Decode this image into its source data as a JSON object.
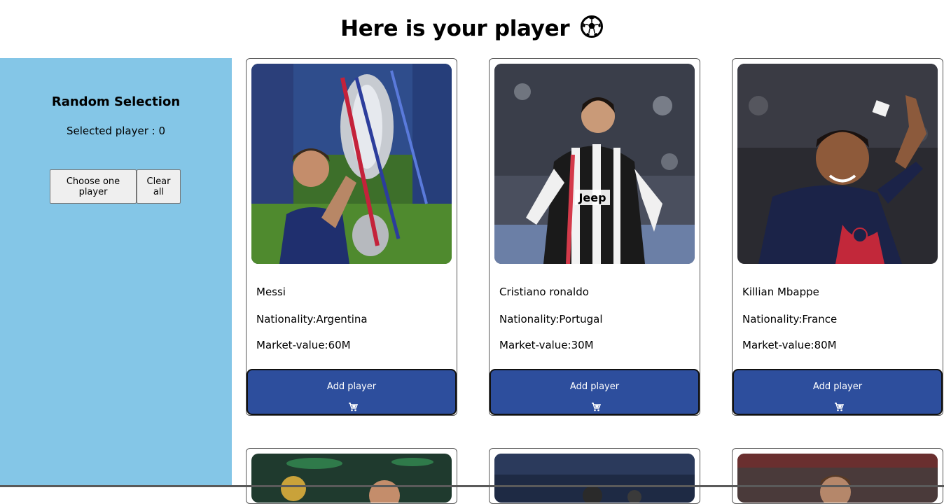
{
  "header": {
    "title": "Here is your player",
    "icon": "soccer-ball-icon"
  },
  "sidebar": {
    "title": "Random Selection",
    "selected_text": "Selected player : 0",
    "choose_label": "Choose one player",
    "clear_label": "Clear all",
    "background": "#84c6e7"
  },
  "cards": [
    {
      "name": "Messi",
      "nationality": "Nationality:Argentina",
      "market_value": "Market-value:60M",
      "button_label": "Add player",
      "button_icon": "cart-icon"
    },
    {
      "name": "Cristiano ronaldo",
      "nationality": "Nationality:Portugal",
      "market_value": "Market-value:30M",
      "button_label": "Add player",
      "button_icon": "cart-icon"
    },
    {
      "name": "Killian Mbappe",
      "nationality": "Nationality:France",
      "market_value": "Market-value:80M",
      "button_label": "Add player",
      "button_icon": "cart-icon"
    }
  ],
  "colors": {
    "accent": "#2d4e9d",
    "sidebar": "#84c6e7"
  }
}
